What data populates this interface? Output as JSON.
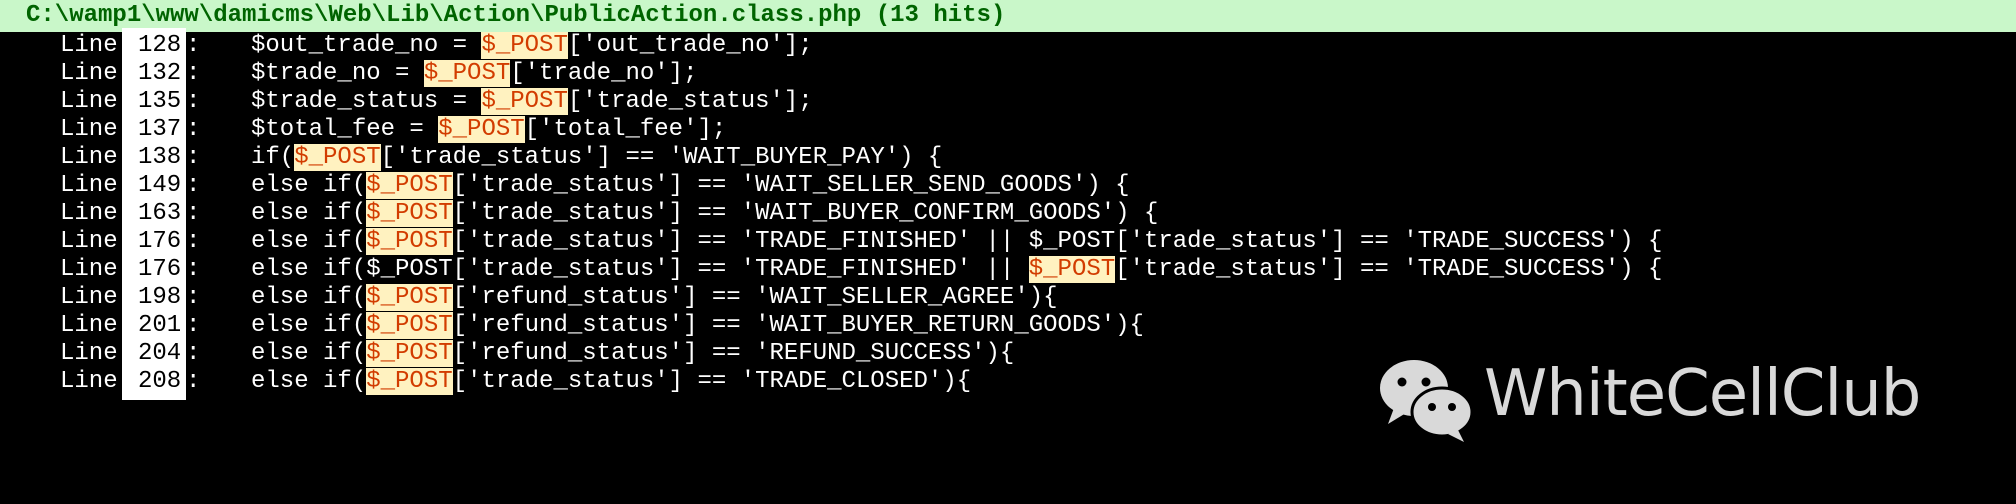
{
  "header": {
    "file_path": "C:\\wamp1\\www\\damicms\\Web\\Lib\\Action\\PublicAction.class.php (13 hits)"
  },
  "colors": {
    "header_bg": "#c9f7c9",
    "header_text": "#006400",
    "highlight_bg": "#fff2c0",
    "highlight_text": "#d23c00"
  },
  "results": [
    {
      "prefix": "Line",
      "num": "128",
      "pre": "$out_trade_no = ",
      "hit": "$_POST",
      "post": "['out_trade_no'];"
    },
    {
      "prefix": "Line",
      "num": "132",
      "pre": "$trade_no = ",
      "hit": "$_POST",
      "post": "['trade_no'];"
    },
    {
      "prefix": "Line",
      "num": "135",
      "pre": "$trade_status = ",
      "hit": "$_POST",
      "post": "['trade_status'];"
    },
    {
      "prefix": "Line",
      "num": "137",
      "pre": "$total_fee = ",
      "hit": "$_POST",
      "post": "['total_fee'];"
    },
    {
      "prefix": "Line",
      "num": "138",
      "pre": "if(",
      "hit": "$_POST",
      "post": "['trade_status'] == 'WAIT_BUYER_PAY') {"
    },
    {
      "prefix": "Line",
      "num": "149",
      "pre": "else if(",
      "hit": "$_POST",
      "post": "['trade_status'] == 'WAIT_SELLER_SEND_GOODS') {"
    },
    {
      "prefix": "Line",
      "num": "163",
      "pre": "else if(",
      "hit": "$_POST",
      "post": "['trade_status'] == 'WAIT_BUYER_CONFIRM_GOODS') {"
    },
    {
      "prefix": "Line",
      "num": "176",
      "pre": "else if(",
      "hit": "$_POST",
      "post": "['trade_status'] == 'TRADE_FINISHED' || $_POST['trade_status'] == 'TRADE_SUCCESS') {"
    },
    {
      "prefix": "Line",
      "num": "176",
      "pre": "else if($_POST['trade_status'] == 'TRADE_FINISHED' || ",
      "hit": "$_POST",
      "post": "['trade_status'] == 'TRADE_SUCCESS') {"
    },
    {
      "prefix": "Line",
      "num": "198",
      "pre": "else if(",
      "hit": "$_POST",
      "post": "['refund_status'] == 'WAIT_SELLER_AGREE'){"
    },
    {
      "prefix": "Line",
      "num": "201",
      "pre": "else if(",
      "hit": "$_POST",
      "post": "['refund_status'] == 'WAIT_BUYER_RETURN_GOODS'){"
    },
    {
      "prefix": "Line",
      "num": "204",
      "pre": "else if(",
      "hit": "$_POST",
      "post": "['refund_status'] == 'REFUND_SUCCESS'){"
    },
    {
      "prefix": "Line",
      "num": "208",
      "pre": "else if(",
      "hit": "$_POST",
      "post": "['trade_status'] == 'TRADE_CLOSED'){"
    }
  ],
  "watermark": {
    "text": "WhiteCellClub",
    "icon": "wechat-icon"
  }
}
